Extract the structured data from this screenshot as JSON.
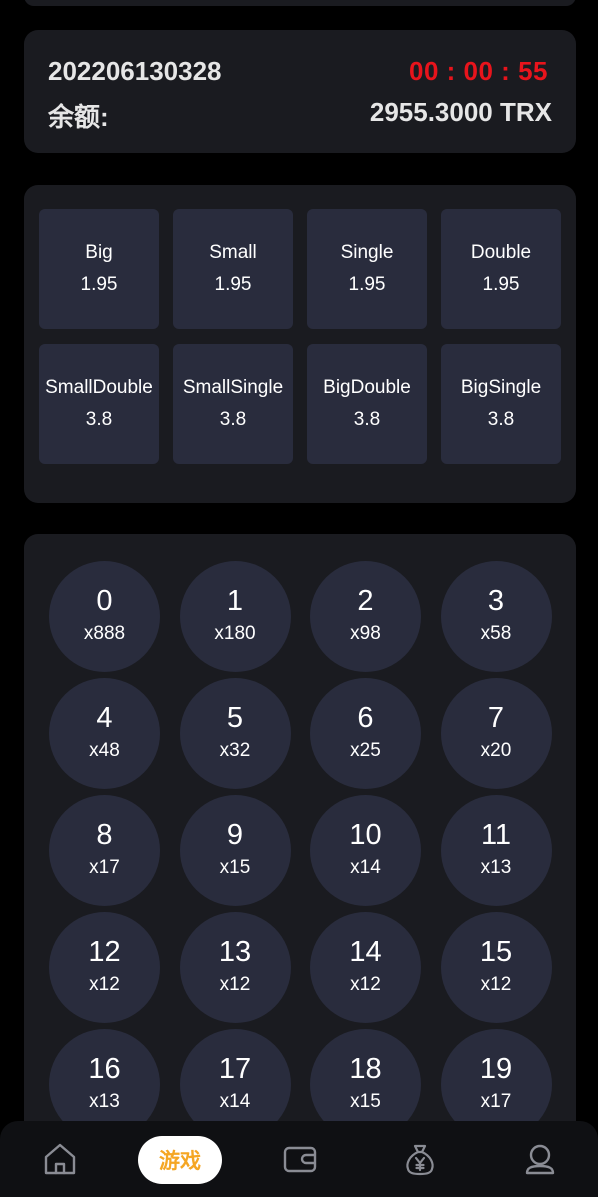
{
  "header": {
    "period": "202206130328",
    "timer": "00 : 00 : 55",
    "balance_label": "余额:",
    "balance_value": "2955.3000 TRX"
  },
  "bets": [
    {
      "name": "Big",
      "odds": "1.95"
    },
    {
      "name": "Small",
      "odds": "1.95"
    },
    {
      "name": "Single",
      "odds": "1.95"
    },
    {
      "name": "Double",
      "odds": "1.95"
    },
    {
      "name": "SmallDouble",
      "odds": "3.8"
    },
    {
      "name": "SmallSingle",
      "odds": "3.8"
    },
    {
      "name": "BigDouble",
      "odds": "3.8"
    },
    {
      "name": "BigSingle",
      "odds": "3.8"
    }
  ],
  "numbers": [
    {
      "num": "0",
      "mult": "x888"
    },
    {
      "num": "1",
      "mult": "x180"
    },
    {
      "num": "2",
      "mult": "x98"
    },
    {
      "num": "3",
      "mult": "x58"
    },
    {
      "num": "4",
      "mult": "x48"
    },
    {
      "num": "5",
      "mult": "x32"
    },
    {
      "num": "6",
      "mult": "x25"
    },
    {
      "num": "7",
      "mult": "x20"
    },
    {
      "num": "8",
      "mult": "x17"
    },
    {
      "num": "9",
      "mult": "x15"
    },
    {
      "num": "10",
      "mult": "x14"
    },
    {
      "num": "11",
      "mult": "x13"
    },
    {
      "num": "12",
      "mult": "x12"
    },
    {
      "num": "13",
      "mult": "x12"
    },
    {
      "num": "14",
      "mult": "x12"
    },
    {
      "num": "15",
      "mult": "x12"
    },
    {
      "num": "16",
      "mult": "x13"
    },
    {
      "num": "17",
      "mult": "x14"
    },
    {
      "num": "18",
      "mult": "x15"
    },
    {
      "num": "19",
      "mult": "x17"
    }
  ],
  "nav": {
    "active_label": "游戏",
    "items": [
      {
        "icon": "home-icon"
      },
      {
        "icon": "game-tab"
      },
      {
        "icon": "wallet-icon"
      },
      {
        "icon": "money-bag-icon"
      },
      {
        "icon": "user-icon"
      }
    ]
  },
  "colors": {
    "background": "#000000",
    "card": "#1a1b20",
    "tile": "#292c3d",
    "timer": "#e8141c",
    "active_tab": "#f5a623"
  }
}
